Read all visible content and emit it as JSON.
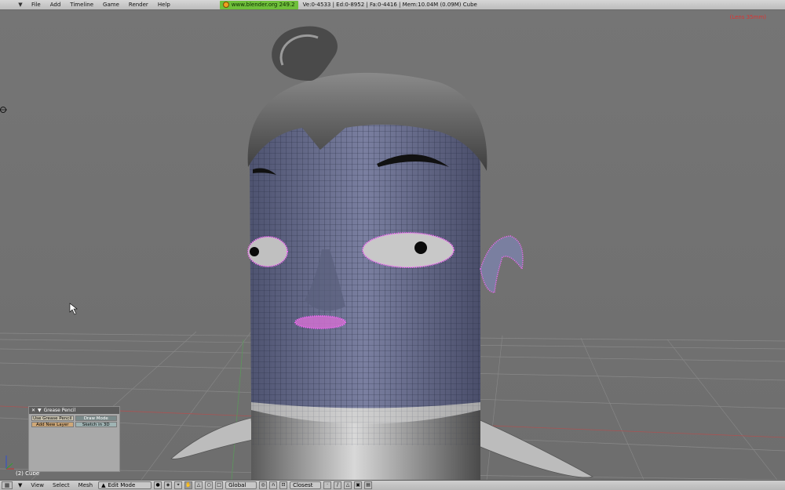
{
  "top_menu": {
    "items": [
      "File",
      "Add",
      "Timeline",
      "Game",
      "Render",
      "Help"
    ],
    "website": "www.blender.org 249.2",
    "stats": "Ve:0-4533 | Ed:0-8952 | Fa:0-4416 | Mem:10.04M (0.09M) Cube"
  },
  "viewport": {
    "red_label": "(Lens 35mm)",
    "object_label": "(2) Cube"
  },
  "grease_pencil": {
    "title": "Grease Pencil",
    "use_button": "Use Grease Pencil",
    "draw_mode_button": "Draw Mode",
    "add_layer_button": "Add New Layer",
    "sketch_button": "Sketch in 3D"
  },
  "bottom_bar": {
    "menus": [
      "View",
      "Select",
      "Mesh"
    ],
    "mode": "Edit Mode",
    "orientation": "Global",
    "snap": "Closest"
  },
  "colors": {
    "viewport_bg": "#757575",
    "mesh_blue": "#6a7090",
    "vertex_select": "#ff66ff",
    "badge_green": "#6fbf3a"
  }
}
